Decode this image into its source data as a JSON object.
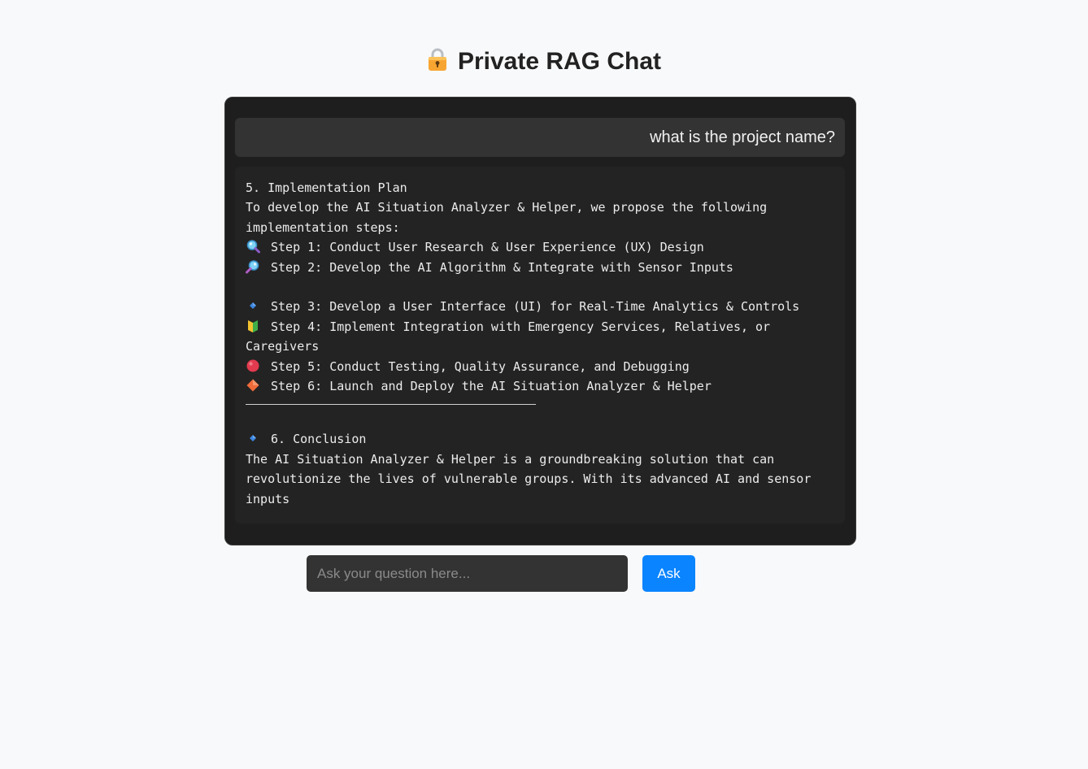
{
  "header": {
    "title": "Private RAG Chat",
    "icon": "lock-icon"
  },
  "chat": {
    "user_message": "what is the project name?",
    "bot_message": {
      "lines": [
        {
          "text": "5. Implementation Plan"
        },
        {
          "text": "To develop the AI Situation Analyzer & Helper, we propose the following"
        },
        {
          "text": "implementation steps:"
        },
        {
          "icon": "magnifier-left-icon",
          "text": "Step 1: Conduct User Research & User Experience (UX) Design"
        },
        {
          "icon": "magnifier-right-icon",
          "text": "Step 2: Develop the AI Algorithm & Integrate with Sensor Inputs"
        },
        {
          "text": ""
        },
        {
          "icon": "small-blue-diamond-icon",
          "text": "Step 3: Develop a User Interface (UI) for Real-Time Analytics & Controls"
        },
        {
          "icon": "beginner-symbol-icon",
          "text": "Step 4: Implement Integration with Emergency Services, Relatives, or"
        },
        {
          "text": "Caregivers"
        },
        {
          "icon": "red-circle-icon",
          "text": "Step 5: Conduct Testing, Quality Assurance, and Debugging"
        },
        {
          "icon": "orange-diamond-icon",
          "text": "Step 6: Launch and Deploy the AI Situation Analyzer & Helper"
        }
      ],
      "conclusion_heading": {
        "icon": "small-blue-diamond-icon",
        "text": "6. Conclusion"
      },
      "conclusion_lines": [
        "The AI Situation Analyzer & Helper is a groundbreaking solution that can",
        "revolutionize the lives of vulnerable groups. With its advanced AI and sensor",
        "inputs"
      ]
    }
  },
  "input": {
    "placeholder": "Ask your question here...",
    "value": ""
  },
  "ask_button": {
    "label": "Ask"
  },
  "colors": {
    "page_background": "#f8f9fa",
    "chat_background": "#1e1e1e",
    "user_bubble": "#333333",
    "bot_bubble": "#232323",
    "accent": "#0a84ff"
  }
}
